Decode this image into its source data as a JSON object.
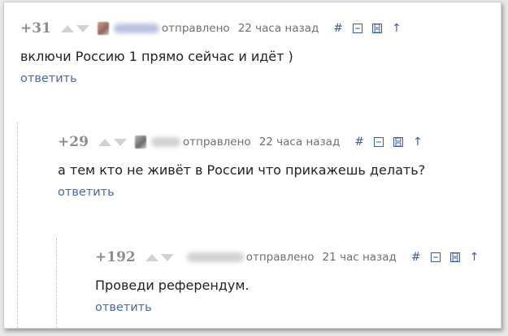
{
  "labels": {
    "sent": "отправлено",
    "reply": "ответить",
    "anchor_symbol": "#",
    "parent_symbol": "↑"
  },
  "colors": {
    "link": "#4a67ad",
    "score": "#8d8d8d",
    "vote_arrow": "#d2d2d2",
    "tool_icon": "#3d5ca0"
  },
  "comments": [
    {
      "score": "+31",
      "time": "22 часа назад",
      "text": "включи Россию 1 прямо сейчас и идёт )"
    },
    {
      "score": "+29",
      "time": "22 часа назад",
      "text": "а тем кто не живёт в России что прикажешь делать?"
    },
    {
      "score": "+192",
      "time": "21 час назад",
      "text": "Проведи референдум."
    }
  ]
}
